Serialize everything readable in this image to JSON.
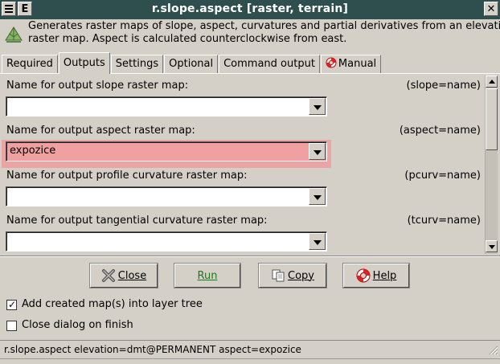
{
  "window": {
    "title": "r.slope.aspect [raster, terrain]",
    "menu_button": "☰",
    "extra_button": "E",
    "close_button": "✕"
  },
  "description": {
    "line1": "Generates raster maps of slope, aspect, curvatures and partial derivatives from an elevatio",
    "line2": "raster map. Aspect is calculated counterclockwise from east."
  },
  "tabs": [
    {
      "label": "Required",
      "active": false
    },
    {
      "label": "Outputs",
      "active": true
    },
    {
      "label": "Settings",
      "active": false
    },
    {
      "label": "Optional",
      "active": false
    },
    {
      "label": "Command output",
      "active": false
    },
    {
      "label": "Manual",
      "active": false,
      "icon": "lifebuoy-icon"
    }
  ],
  "fields": [
    {
      "label": "Name for output slope raster map:",
      "key": "(slope=name)",
      "value": ""
    },
    {
      "label": "Name for output aspect raster map:",
      "key": "(aspect=name)",
      "value": "expozice"
    },
    {
      "label": "Name for output profile curvature raster map:",
      "key": "(pcurv=name)",
      "value": ""
    },
    {
      "label": "Name for output tangential curvature raster map:",
      "key": "(tcurv=name)",
      "value": ""
    }
  ],
  "buttons": {
    "close": "Close",
    "run": "Run",
    "copy": "Copy",
    "help": "Help"
  },
  "checkboxes": [
    {
      "label": "Add created map(s) into layer tree",
      "checked": true,
      "mark": "✓"
    },
    {
      "label": "Close dialog on finish",
      "checked": false,
      "mark": ""
    }
  ],
  "status": "r.slope.aspect elevation=dmt@PERMANENT aspect=expozice",
  "colors": {
    "titlebar": "#2f4f4f",
    "highlight": "#eba3a3",
    "run_text": "#1a7a1a"
  }
}
